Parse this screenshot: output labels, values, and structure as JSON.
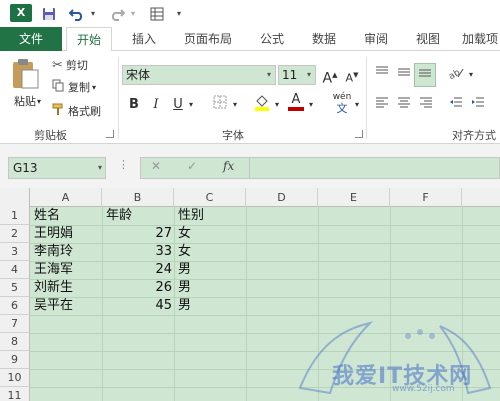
{
  "quick_access": {
    "logo": "X",
    "save_icon": "save-icon",
    "undo_icon": "undo-icon",
    "redo_icon": "redo-icon"
  },
  "tabs": [
    {
      "label": "文件"
    },
    {
      "label": "开始"
    },
    {
      "label": "插入"
    },
    {
      "label": "页面布局"
    },
    {
      "label": "公式"
    },
    {
      "label": "数据"
    },
    {
      "label": "审阅"
    },
    {
      "label": "视图"
    },
    {
      "label": "加载项"
    }
  ],
  "clipboard": {
    "paste_label": "粘贴",
    "cut_label": "剪切",
    "copy_label": "复制",
    "format_painter_label": "格式刷",
    "group_label": "剪贴板"
  },
  "font": {
    "name": "宋体",
    "size": "11",
    "bold": "B",
    "italic": "I",
    "underline": "U",
    "grow": "A",
    "shrink": "A",
    "phonetic": "wén",
    "font_color": "A",
    "group_label": "字体"
  },
  "alignment": {
    "group_label": "对齐方式"
  },
  "formula_bar": {
    "name_box": "G13",
    "cancel": "✕",
    "enter": "✓",
    "fx": "fx",
    "formula": ""
  },
  "columns": [
    "A",
    "B",
    "C",
    "D",
    "E",
    "F"
  ],
  "rows": [
    "1",
    "2",
    "3",
    "4",
    "5",
    "6",
    "7",
    "8",
    "9",
    "10",
    "11"
  ],
  "cells": {
    "header": [
      "姓名",
      "年龄",
      "性别"
    ],
    "data": [
      [
        "王明娟",
        "27",
        "女"
      ],
      [
        "李南玲",
        "33",
        "女"
      ],
      [
        "王海军",
        "24",
        "男"
      ],
      [
        "刘新生",
        "26",
        "男"
      ],
      [
        "吴平在",
        "45",
        "男"
      ]
    ]
  },
  "watermark": {
    "text": "我爱IT技术网",
    "url": "www.52ij.com"
  },
  "colors": {
    "brand": "#217346",
    "cell_fill": "#cfe6d2",
    "font_color_bar": "#c00000",
    "highlight_bar": "#ffff00"
  }
}
